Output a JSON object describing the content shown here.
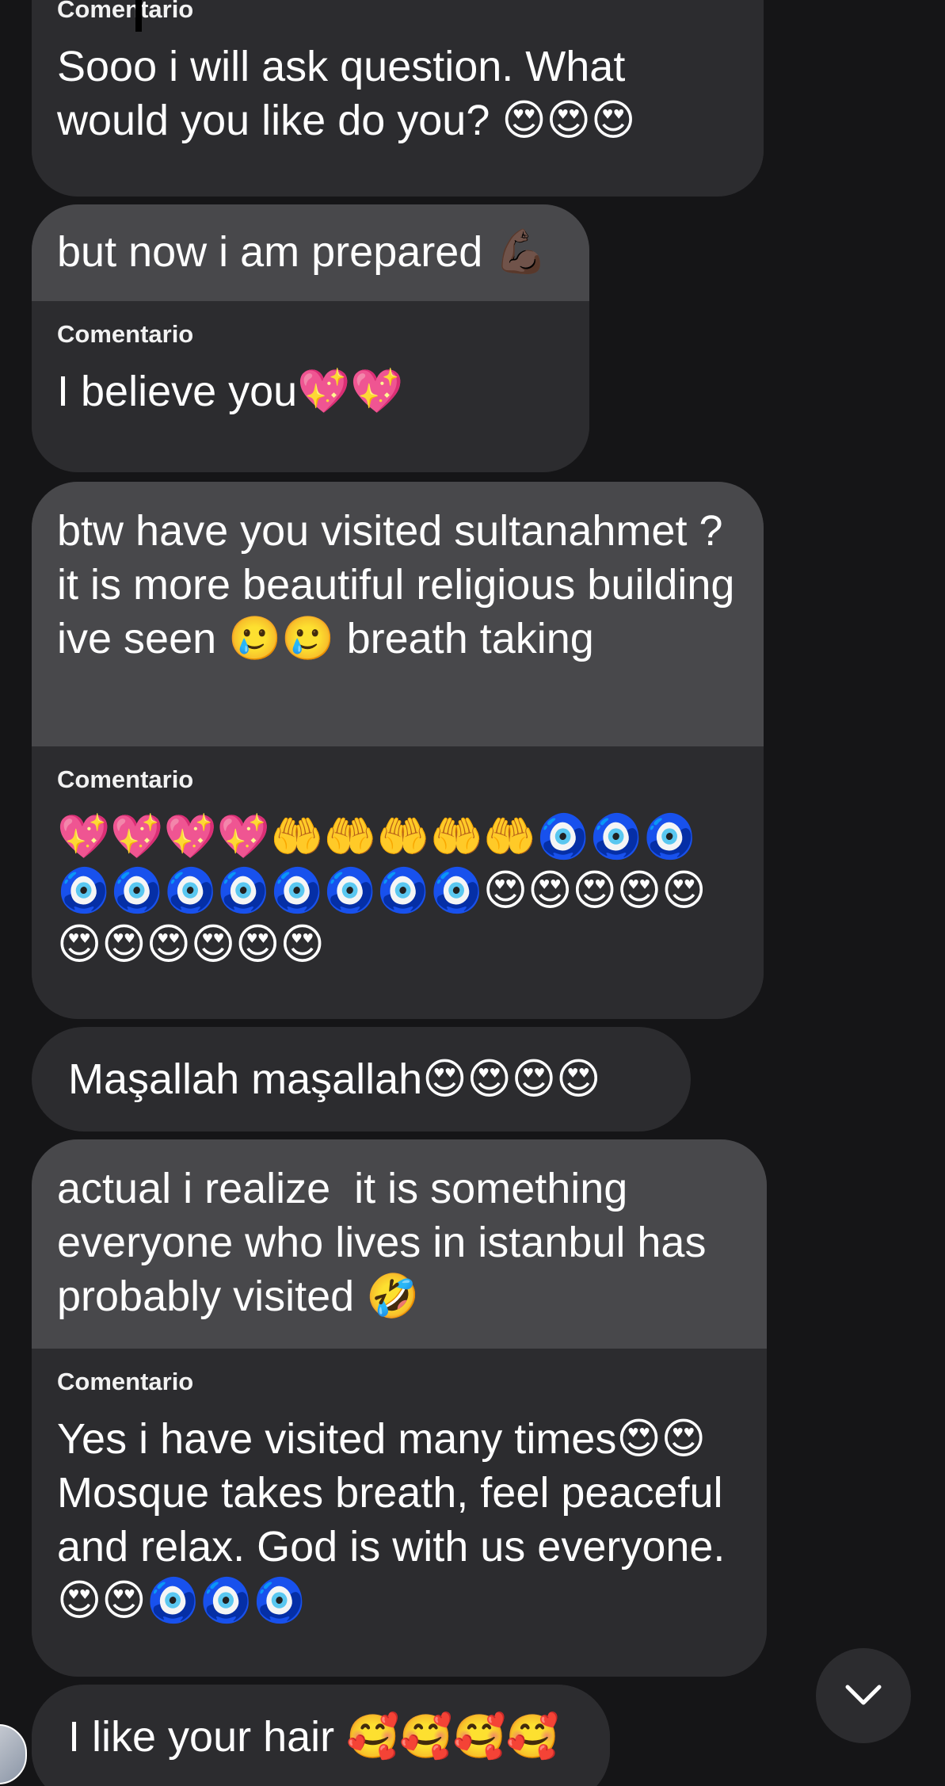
{
  "messages": [
    {
      "reply_label": "Comentario",
      "reply_text": "Sooo i will ask question. What would you like do you? 😍😍😍"
    },
    {
      "quoted_text": "but now i am prepared 💪🏿",
      "reply_label": "Comentario",
      "reply_text": "I believe you💖💖"
    },
    {
      "quoted_text": "btw have you visited sultanahmet ? it is more beautiful religious building ive seen 🥲🥲 breath taking",
      "reply_label": "Comentario",
      "reply_text": "💖💖💖💖🤲🤲🤲🤲🤲🧿🧿🧿🧿🧿🧿🧿🧿🧿🧿🧿😍😍😍😍😍😍😍😍😍😍😍"
    },
    {
      "text": "Maşallah maşallah😍😍😍😍"
    },
    {
      "quoted_text": "actual i realize  it is something everyone who lives in istanbul has probably visited 🤣",
      "reply_label": "Comentario",
      "reply_text": "Yes i have visited many times😍😍 Mosque takes breath, feel peaceful and relax. God is with us everyone. 😍😍🧿🧿🧿"
    },
    {
      "text": "I like your hair 🥰🥰🥰🥰"
    }
  ],
  "controls": {
    "scroll_down_icon": "chevron-down-icon",
    "avatar_icon": "user-avatar"
  },
  "colors": {
    "background": "#151517",
    "bubble": "#2c2c2f",
    "quoted_bubble": "#48484b",
    "text": "#ffffff"
  }
}
